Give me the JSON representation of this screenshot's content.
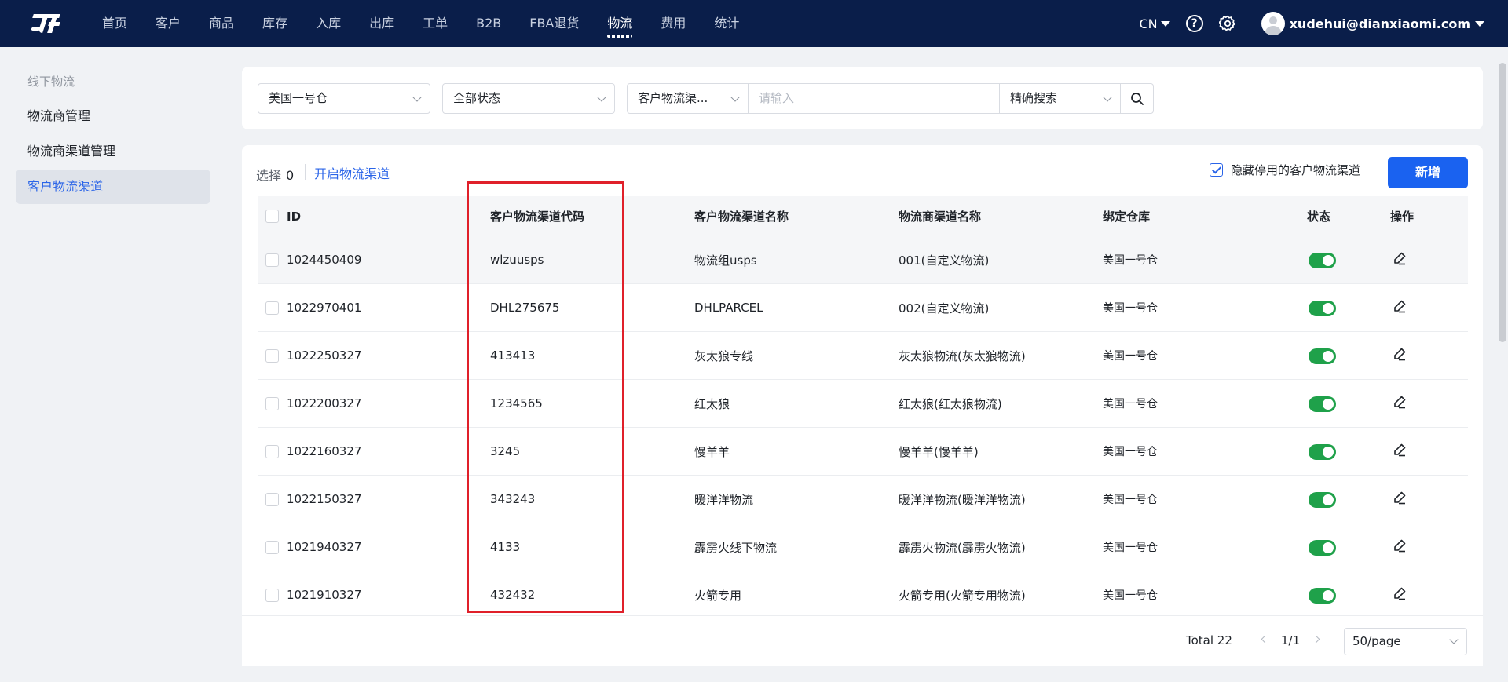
{
  "nav": {
    "items": [
      "首页",
      "客户",
      "商品",
      "库存",
      "入库",
      "出库",
      "工单",
      "B2B",
      "FBA退货",
      "物流",
      "费用",
      "统计"
    ],
    "active_index": 9,
    "lang": "CN",
    "user_email": "xudehui@dianxiaomi.com"
  },
  "sidebar": {
    "group_label": "线下物流",
    "items": [
      "物流商管理",
      "物流商渠道管理",
      "客户物流渠道"
    ],
    "active_index": 2
  },
  "filters": {
    "warehouse": "美国一号仓",
    "status": "全部状态",
    "field": "客户物流渠...",
    "search_placeholder": "请输入",
    "match_mode": "精确搜索"
  },
  "toolbar": {
    "select_label": "选择",
    "select_count": "0",
    "open_channel": "开启物流渠道",
    "hide_disabled": "隐藏停用的客户物流渠道",
    "add_button": "新增"
  },
  "table": {
    "headers": [
      "ID",
      "客户物流渠道代码",
      "客户物流渠道名称",
      "物流商渠道名称",
      "绑定仓库",
      "状态",
      "操作"
    ],
    "rows": [
      {
        "id": "1024450409",
        "code": "wlzuusps",
        "name": "物流组usps",
        "carrier": "001(自定义物流)",
        "warehouse": "美国一号仓"
      },
      {
        "id": "1022970401",
        "code": "DHL275675",
        "name": "DHLPARCEL",
        "carrier": "002(自定义物流)",
        "warehouse": "美国一号仓"
      },
      {
        "id": "1022250327",
        "code": "413413",
        "name": "灰太狼专线",
        "carrier": "灰太狼物流(灰太狼物流)",
        "warehouse": "美国一号仓"
      },
      {
        "id": "1022200327",
        "code": "1234565",
        "name": "红太狼",
        "carrier": "红太狼(红太狼物流)",
        "warehouse": "美国一号仓"
      },
      {
        "id": "1022160327",
        "code": "3245",
        "name": "慢羊羊",
        "carrier": "慢羊羊(慢羊羊)",
        "warehouse": "美国一号仓"
      },
      {
        "id": "1022150327",
        "code": "343243",
        "name": "暖洋洋物流",
        "carrier": "暖洋洋物流(暖洋洋物流)",
        "warehouse": "美国一号仓"
      },
      {
        "id": "1021940327",
        "code": "4133",
        "name": "霹雳火线下物流",
        "carrier": "霹雳火物流(霹雳火物流)",
        "warehouse": "美国一号仓"
      },
      {
        "id": "1021910327",
        "code": "432432",
        "name": "火箭专用",
        "carrier": "火箭专用(火箭专用物流)",
        "warehouse": "美国一号仓"
      }
    ]
  },
  "pager": {
    "total": "Total 22",
    "page": "1/1",
    "page_size": "50/page"
  },
  "colors": {
    "nav_bg": "#0a1e4a",
    "accent": "#1a62f0",
    "toggle_on": "#1fa14a",
    "highlight": "#e0202a"
  },
  "icons": [
    "logo-icon",
    "help-icon",
    "gear-icon",
    "avatar-icon",
    "search-icon",
    "edit-icon",
    "chevron-down-icon"
  ]
}
